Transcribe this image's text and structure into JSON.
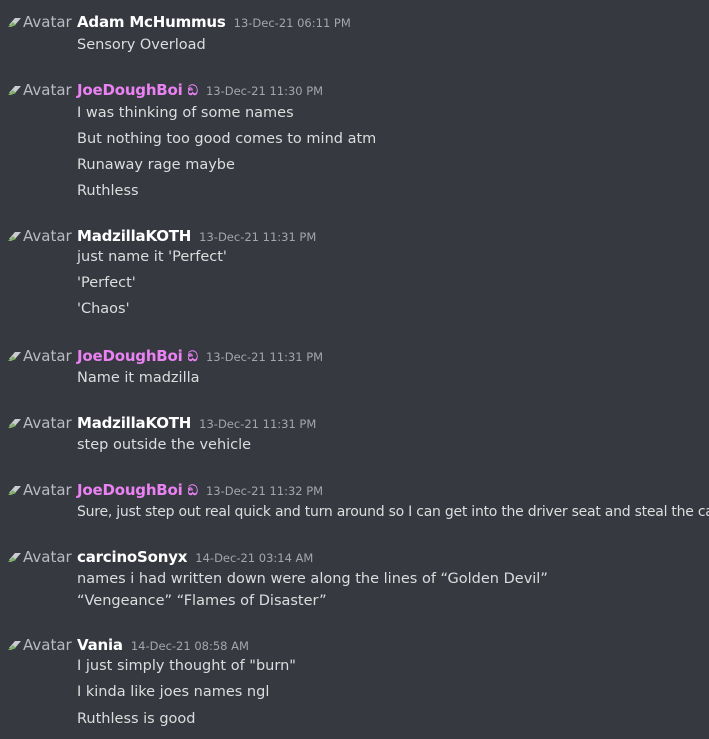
{
  "avatar_alt": "Avatar",
  "colors": {
    "background": "#36393f",
    "username_default": "#ffffff",
    "username_highlight": "#ea82f4",
    "message_text": "#dcddde",
    "timestamp": "#a3a6aa"
  },
  "messages": [
    {
      "author": "Adam McHummus",
      "timestamp": "13-Dec-21 06:11 PM",
      "lines": [
        "Sensory Overload"
      ]
    },
    {
      "author": "JoeDoughBoi",
      "badge": "ඞ",
      "timestamp": "13-Dec-21 11:30 PM",
      "lines": [
        "I was thinking of some names",
        "But nothing too good comes to mind atm",
        "Runaway rage maybe",
        "Ruthless"
      ]
    },
    {
      "author": "MadzillaKOTH",
      "timestamp": "13-Dec-21 11:31 PM",
      "lines": [
        "just name it 'Perfect'",
        "'Perfect'",
        "'Chaos'"
      ]
    },
    {
      "author": "JoeDoughBoi",
      "badge": "ඞ",
      "timestamp": "13-Dec-21 11:31 PM",
      "lines": [
        "Name it madzilla"
      ]
    },
    {
      "author": "MadzillaKOTH",
      "timestamp": "13-Dec-21 11:31 PM",
      "lines": [
        "step outside the vehicle"
      ]
    },
    {
      "author": "JoeDoughBoi",
      "badge": "ඞ",
      "timestamp": "13-Dec-21 11:32 PM",
      "lines": [
        "Sure, just step out real quick and turn around so I can get into the driver seat and steal the car"
      ]
    },
    {
      "author": "carcinoSonyx",
      "timestamp": "14-Dec-21 03:14 AM",
      "lines": [
        "names i had written down were along the lines of “Golden Devil”",
        "“Vengeance” “Flames of Disaster”"
      ]
    },
    {
      "author": "Vania",
      "timestamp": "14-Dec-21 08:58 AM",
      "lines": [
        "I just simply thought of \"burn\"",
        "I kinda like joes names ngl",
        "Ruthless is good"
      ]
    }
  ]
}
